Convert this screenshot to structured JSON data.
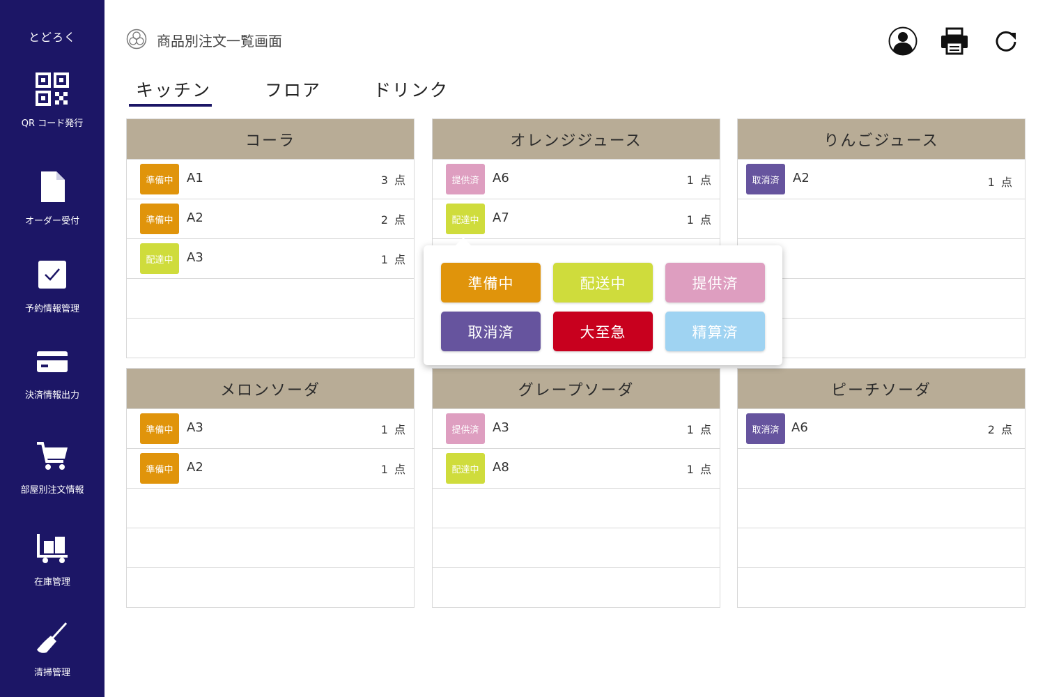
{
  "colors": {
    "sidebar_bg": "#1c1666",
    "card_header_bg": "#b8ac96",
    "status_preparing": "#e0940b",
    "status_delivering": "#cfdc3c",
    "status_served": "#de9ec0",
    "status_cancelled": "#66549e",
    "status_urgent": "#c8001e",
    "status_paid": "#9fd3f2"
  },
  "sidebar": {
    "brand": "とどろく",
    "items": [
      {
        "label": "QR コード発行",
        "icon": "qr-code-icon"
      },
      {
        "label": "オーダー受付",
        "icon": "document-icon"
      },
      {
        "label": "予約情報管理",
        "icon": "checkbox-icon"
      },
      {
        "label": "決済情報出力",
        "icon": "credit-card-icon"
      },
      {
        "label": "部屋別注文情報",
        "icon": "cart-icon"
      },
      {
        "label": "在庫管理",
        "icon": "inventory-cart-icon"
      },
      {
        "label": "清掃管理",
        "icon": "broom-icon"
      }
    ]
  },
  "header": {
    "title": "商品別注文一覧画面",
    "logo_icon": "crest-logo-icon",
    "actions": [
      "user-icon",
      "printer-icon",
      "refresh-icon"
    ]
  },
  "tabs": [
    {
      "label": "キッチン",
      "active": true
    },
    {
      "label": "フロア",
      "active": false
    },
    {
      "label": "ドリンク",
      "active": false
    }
  ],
  "cards": [
    {
      "title": "コーラ",
      "orders": [
        {
          "status": "準備中",
          "table": "A1",
          "qty": "3 点"
        },
        {
          "status": "準備中",
          "table": "A2",
          "qty": "2 点"
        },
        {
          "status": "配達中",
          "table": "A3",
          "qty": "1 点"
        }
      ]
    },
    {
      "title": "オレンジジュース",
      "orders": [
        {
          "status": "提供済",
          "table": "A6",
          "qty": "1 点"
        },
        {
          "status": "配達中",
          "table": "A7",
          "qty": "1 点"
        }
      ]
    },
    {
      "title": "りんごジュース",
      "orders": [
        {
          "status": "取消済",
          "table": "A2",
          "qty": "1 点"
        }
      ]
    },
    {
      "title": "メロンソーダ",
      "orders": [
        {
          "status": "準備中",
          "table": "A3",
          "qty": "1 点"
        },
        {
          "status": "準備中",
          "table": "A2",
          "qty": "1 点"
        }
      ]
    },
    {
      "title": "グレープソーダ",
      "orders": [
        {
          "status": "提供済",
          "table": "A3",
          "qty": "1 点"
        },
        {
          "status": "配達中",
          "table": "A8",
          "qty": "1 点"
        }
      ]
    },
    {
      "title": "ピーチソーダ",
      "orders": [
        {
          "status": "取消済",
          "table": "A6",
          "qty": "2 点"
        }
      ]
    }
  ],
  "status_popup": {
    "options": [
      "準備中",
      "配送中",
      "提供済",
      "取消済",
      "大至急",
      "精算済"
    ]
  }
}
